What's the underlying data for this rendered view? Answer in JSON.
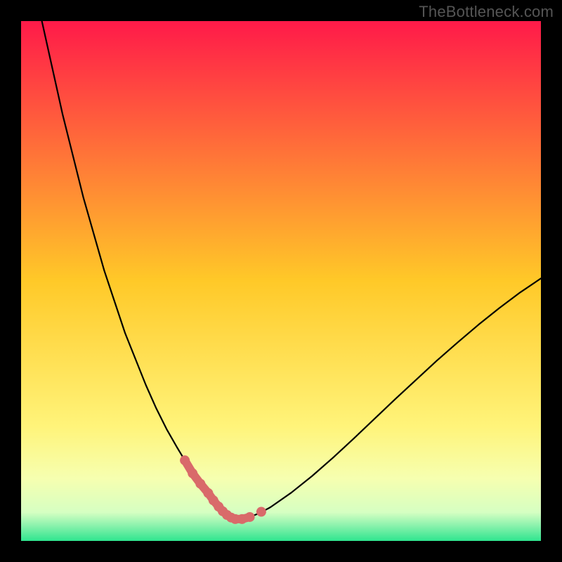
{
  "watermark": "TheBottleneck.com",
  "chart_data": {
    "type": "line",
    "title": "",
    "xlabel": "",
    "ylabel": "",
    "xlim": [
      0,
      100
    ],
    "ylim": [
      0,
      100
    ],
    "grid": false,
    "legend": false,
    "background_gradient": {
      "stops": [
        {
          "offset": 0.0,
          "color": "#ff1a49"
        },
        {
          "offset": 0.5,
          "color": "#ffc928"
        },
        {
          "offset": 0.78,
          "color": "#fff47a"
        },
        {
          "offset": 0.88,
          "color": "#f6ffb0"
        },
        {
          "offset": 0.945,
          "color": "#d6ffc2"
        },
        {
          "offset": 0.97,
          "color": "#8cf2ad"
        },
        {
          "offset": 1.0,
          "color": "#2fe58f"
        }
      ]
    },
    "series": [
      {
        "name": "bottleneck-curve",
        "type": "line",
        "color": "#000000",
        "x": [
          4,
          6,
          8,
          10,
          12,
          14,
          16,
          18,
          20,
          22,
          24,
          26,
          28,
          30,
          31.5,
          33,
          34.5,
          36,
          37,
          38,
          38.8,
          39.6,
          40.4,
          41.2,
          42.5,
          44,
          46,
          48,
          52,
          56,
          60,
          64,
          68,
          72,
          76,
          80,
          84,
          88,
          92,
          96,
          100
        ],
        "y": [
          100,
          91,
          82,
          74,
          66,
          59,
          52,
          46,
          40,
          35,
          30,
          25.5,
          21.5,
          18,
          15.5,
          13,
          11,
          9.2,
          7.8,
          6.6,
          5.7,
          5.0,
          4.5,
          4.2,
          4.2,
          4.6,
          5.4,
          6.5,
          9.3,
          12.5,
          16.0,
          19.7,
          23.5,
          27.3,
          31.0,
          34.7,
          38.2,
          41.6,
          44.8,
          47.8,
          50.5
        ]
      },
      {
        "name": "marker-cluster",
        "type": "scatter_line",
        "color": "#d96a6a",
        "stroke_width": 12,
        "x": [
          31.5,
          33.0,
          34.5,
          36.0,
          37.0,
          38.0,
          38.8,
          39.6,
          40.4,
          41.2,
          42.5,
          44.0
        ],
        "y": [
          15.5,
          13.0,
          11.0,
          9.2,
          7.8,
          6.6,
          5.7,
          5.0,
          4.5,
          4.2,
          4.2,
          4.6
        ],
        "point_radius": 7
      },
      {
        "name": "marker-single",
        "type": "scatter",
        "color": "#d96a6a",
        "x": [
          46.2
        ],
        "y": [
          5.6
        ],
        "point_radius": 7
      }
    ]
  }
}
